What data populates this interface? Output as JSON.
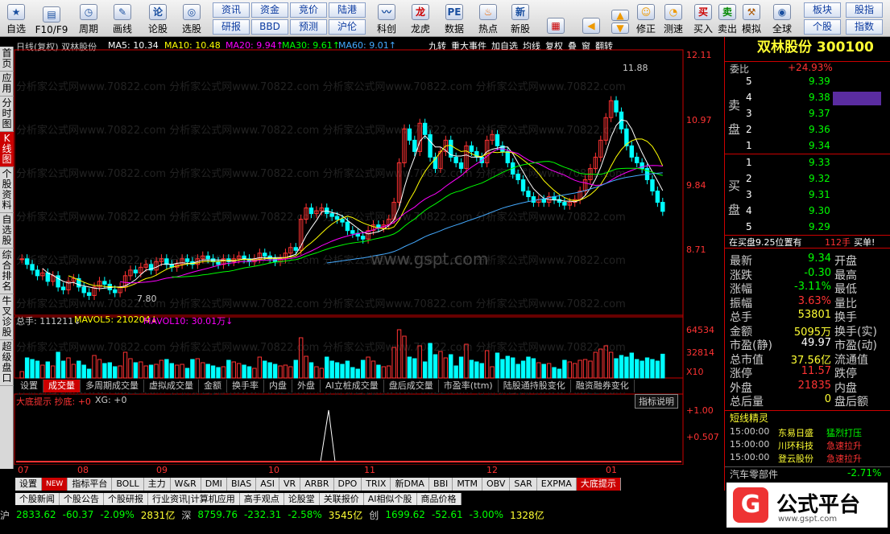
{
  "toolbar": {
    "items": [
      {
        "label": "自选"
      },
      {
        "label": "F10/F9"
      },
      {
        "label": "周期"
      },
      {
        "label": "画线"
      },
      {
        "label": "论股"
      },
      {
        "label": "选股"
      }
    ],
    "pairs": [
      {
        "top": "资讯",
        "bottom": "研报"
      },
      {
        "top": "资金",
        "bottom": "BBD"
      },
      {
        "top": "竞价",
        "bottom": "预测"
      },
      {
        "top": "陆港",
        "bottom": "沪伦"
      }
    ],
    "items2": [
      {
        "label": "科创"
      },
      {
        "label": "龙虎"
      },
      {
        "label": "数据"
      },
      {
        "label": "热点"
      },
      {
        "label": "新股"
      }
    ],
    "items3": [
      {
        "label": "修正"
      },
      {
        "label": "测速"
      },
      {
        "label": "买入"
      },
      {
        "label": "卖出"
      },
      {
        "label": "模拟"
      },
      {
        "label": "全球"
      }
    ],
    "pairs2": [
      {
        "top": "板块",
        "bottom": "个股"
      },
      {
        "top": "股指",
        "bottom": "指数"
      }
    ]
  },
  "leftbar": [
    "首页",
    "应用",
    "分时图",
    "K线图",
    "个股资料",
    "自选股",
    "综合排名",
    "牛叉诊股",
    "超级盘口"
  ],
  "chart_info": {
    "title": "日线(复权) 双林股份",
    "ma5": "MA5: 10.34",
    "ma10": "MA10: 10.48",
    "ma20": "MA20: 9.94↑",
    "ma30": "MA30: 9.61↑",
    "ma60": "MA60: 9.01↑",
    "vol": "总手: 111211↓",
    "mavol5": "MAVOL5: 210204↓",
    "mavol10": "MAVOL10: 30.01万↓",
    "ind": "大底提示 抄底: +0",
    "xg": "XG: +0",
    "top_btns": [
      "九转",
      "重大事件",
      "加自选",
      "均线",
      "复权",
      "叠",
      "窗",
      "翻转"
    ],
    "ind_btn": "指标说明",
    "high_label": "11.88",
    "low_label": "7.80",
    "watermark": "www.gspt.com"
  },
  "y_ticks": [
    "12.11",
    "10.97",
    "9.84",
    "8.71"
  ],
  "vol_ticks": [
    "64534",
    "32814",
    "X10"
  ],
  "ind_ticks": [
    "+1.00",
    "+0.507"
  ],
  "x_months": [
    "07",
    "08",
    "09",
    "10",
    "11",
    "12",
    "01"
  ],
  "tabs": [
    "设置",
    "成交量",
    "多周期成交量",
    "虚拟成交量",
    "金额",
    "换手率",
    "内盘",
    "外盘",
    "AI立桩成交量",
    "盘后成交量",
    "市盈率(ttm)",
    "陆股通持股变化",
    "融资融券变化"
  ],
  "bottom_tabs": [
    "设置",
    "NEW",
    "指标平台",
    "BOLL",
    "主力",
    "W&R",
    "DMI",
    "BIAS",
    "ASI",
    "VR",
    "ARBR",
    "DPO",
    "TRIX",
    "新DMA",
    "BBI",
    "MTM",
    "OBV",
    "SAR",
    "EXPMA",
    "大底提示"
  ],
  "news_tabs": [
    "个股新闻",
    "个股公告",
    "个股研报",
    "行业资讯|计算机应用",
    "高手观点",
    "论股堂",
    "关联报价",
    "AI相似个股",
    "商品价格"
  ],
  "status": [
    {
      "name": "沪",
      "val": "2833.62",
      "chg": "-60.37",
      "pct": "-2.09%",
      "amt": "2831亿"
    },
    {
      "name": "深",
      "val": "8759.76",
      "chg": "-232.31",
      "pct": "-2.58%",
      "amt": "3545亿"
    },
    {
      "name": "创",
      "val": "1699.62",
      "chg": "-52.61",
      "pct": "-3.00%",
      "amt": "1328亿"
    }
  ],
  "right": {
    "title": "双林股份 300100",
    "webi_label": "委比",
    "webi": "+24.93%",
    "sell_label": "卖盘",
    "buy_label": "买盘",
    "sell": [
      [
        "5",
        "9.39"
      ],
      [
        "4",
        "9.38"
      ],
      [
        "3",
        "9.37"
      ],
      [
        "2",
        "9.36"
      ],
      [
        "1",
        "9.34"
      ]
    ],
    "buy": [
      [
        "1",
        "9.33"
      ],
      [
        "2",
        "9.32"
      ],
      [
        "3",
        "9.31"
      ],
      [
        "4",
        "9.30"
      ],
      [
        "5",
        "9.29"
      ]
    ],
    "bid_note": "在买盘9.25位置有",
    "bid_qty": "112手",
    "bid_tag": "买单!",
    "stats": [
      [
        "最新",
        "9.34",
        "开盘"
      ],
      [
        "涨跌",
        "-0.30",
        "最高"
      ],
      [
        "涨幅",
        "-3.11%",
        "最低"
      ],
      [
        "振幅",
        "3.63%",
        "量比"
      ],
      [
        "总手",
        "53801",
        "换手"
      ],
      [
        "金额",
        "5095万",
        "换手(实)"
      ],
      [
        "市盈(静)",
        "49.97",
        "市盈(动)"
      ],
      [
        "总市值",
        "37.56亿",
        "流通值"
      ],
      [
        "涨停",
        "11.57",
        "跌停"
      ],
      [
        "外盘",
        "21835",
        "内盘"
      ],
      [
        "总后量",
        "0",
        "盘后额"
      ]
    ],
    "short_title": "短线精灵",
    "short": [
      [
        "15:00:00",
        "东易日盛",
        "猛烈打压"
      ],
      [
        "15:00:00",
        "川环科技",
        "急速拉升"
      ],
      [
        "15:00:00",
        "登云股份",
        "急速拉升"
      ]
    ],
    "sector": "汽车零部件",
    "sector_pct": "-2.71%"
  },
  "logo": {
    "text": "公式平台",
    "url": "www.gspt.com"
  },
  "chart_data": {
    "type": "candlestick",
    "note_high": 11.88,
    "note_low": 7.8,
    "ylim": [
      7.5,
      12.2
    ]
  }
}
